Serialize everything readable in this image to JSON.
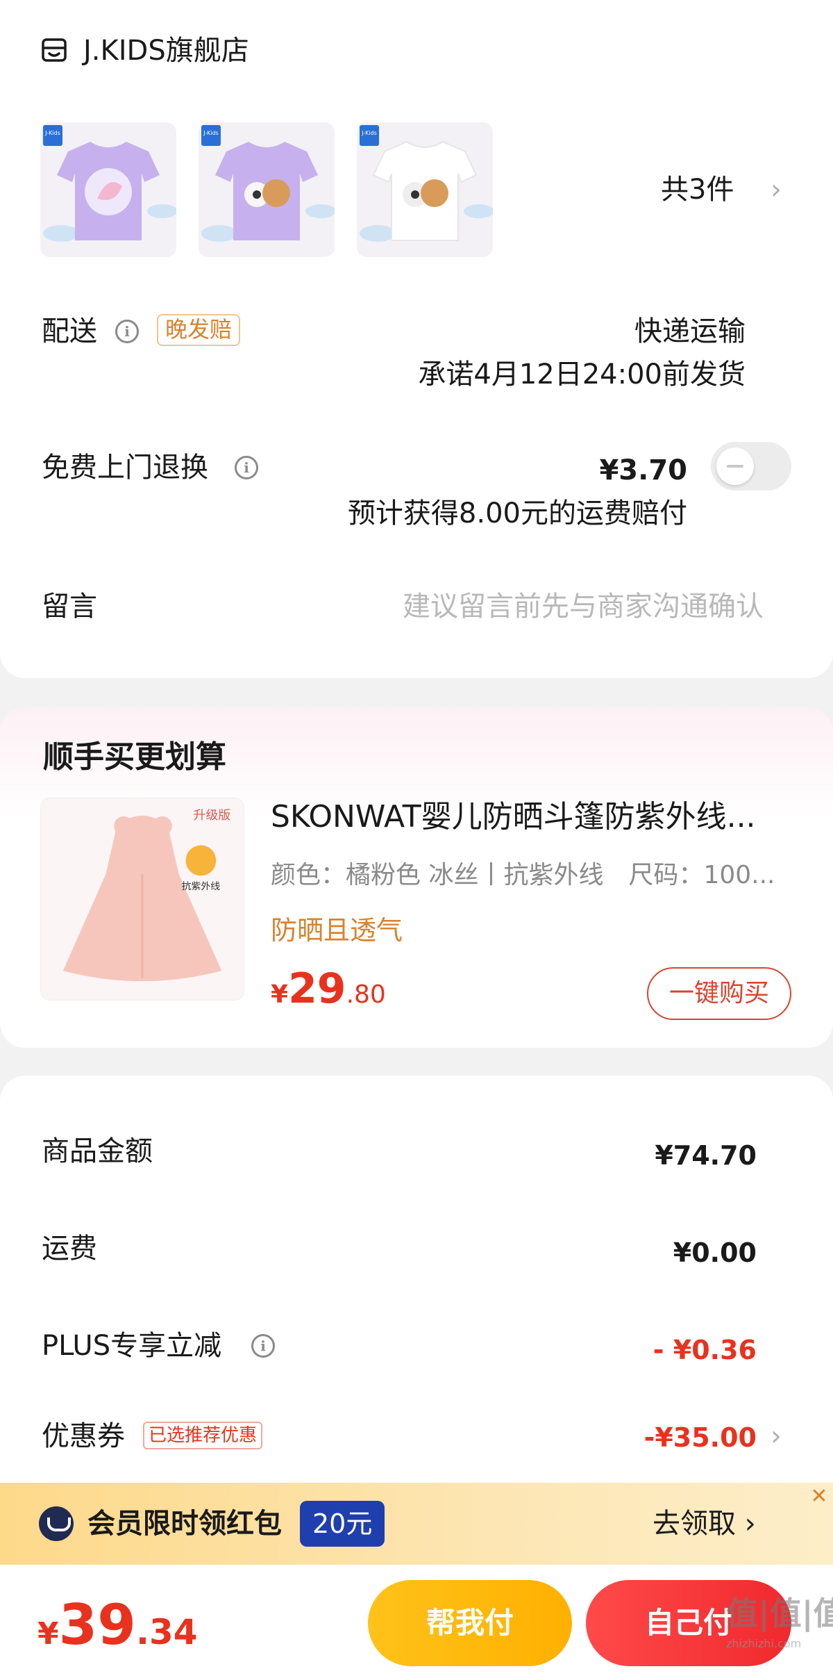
{
  "store": {
    "name": "J.KIDS旗舰店",
    "icon": "store-icon"
  },
  "items": {
    "count_label": "共3件",
    "thumb_brand": "J-Kids"
  },
  "delivery": {
    "label": "配送",
    "tag": "晚发赔",
    "method": "快递运输",
    "promise": "承诺4月12日24:00前发货"
  },
  "return_service": {
    "label": "免费上门退换",
    "price": "¥3.70",
    "note": "预计获得8.00元的运费赔付",
    "toggle_on": false
  },
  "message": {
    "label": "留言",
    "placeholder": "建议留言前先与商家沟通确认"
  },
  "upsell": {
    "title": "顺手买更划算",
    "product_name": "SKONWAT婴儿防晒斗篷防紫外线...",
    "spec": "颜色：橘粉色 冰丝丨抗紫外线　尺码：100...",
    "tag": "防晒且透气",
    "price_symbol": "¥",
    "price_int": "29",
    "price_dec": ".80",
    "buy_label": "一键购买",
    "image_badge": "升级版",
    "image_uv": "抗紫外线"
  },
  "summary": {
    "goods_label": "商品金额",
    "goods_value": "¥74.70",
    "shipping_label": "运费",
    "shipping_value": "¥0.00",
    "plus_label": "PLUS专享立减",
    "plus_value": "- ¥0.36",
    "coupon_label": "优惠券",
    "coupon_tag": "已选推荐优惠",
    "coupon_value": "-¥35.00"
  },
  "banner": {
    "text": "会员限时领红包",
    "badge": "20元",
    "cta": "去领取 ›",
    "close": "✕"
  },
  "bottom": {
    "total_symbol": "¥",
    "total_int": "39",
    "total_dec": ".34",
    "pay_friend": "帮我付",
    "pay_self": "自己付",
    "watermark": "值|值|值",
    "watermark_sub": "zhizhizhi.com"
  },
  "colors": {
    "accent_red": "#e8321e",
    "accent_orange": "#d9822b",
    "pay_friend": "#ffb000",
    "pay_self": "#f0292e",
    "badge_blue": "#1f3fae"
  }
}
